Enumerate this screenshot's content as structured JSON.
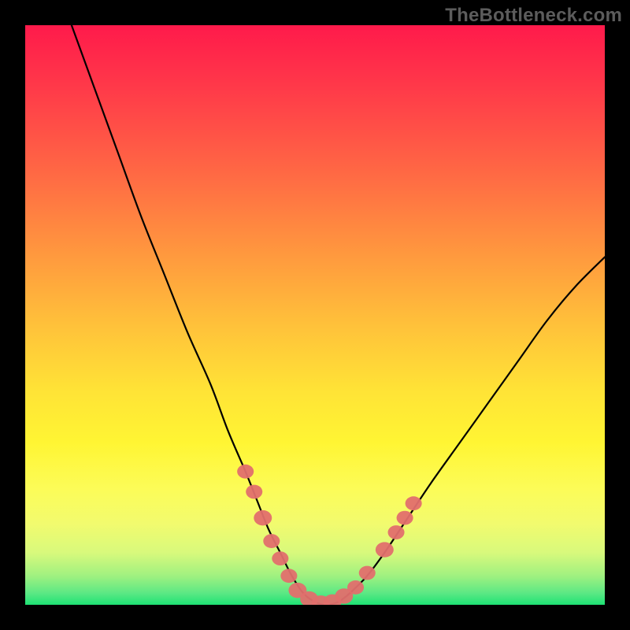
{
  "attribution": "TheBottleneck.com",
  "chart_data": {
    "type": "line",
    "title": "",
    "xlabel": "",
    "ylabel": "",
    "xlim": [
      0,
      100
    ],
    "ylim": [
      0,
      100
    ],
    "series": [
      {
        "name": "bottleneck-curve",
        "x": [
          8,
          12,
          16,
          20,
          24,
          28,
          32,
          35,
          38,
          40,
          42,
          44,
          46,
          48,
          50,
          52,
          54,
          56,
          59,
          62,
          66,
          70,
          75,
          80,
          85,
          90,
          95,
          100
        ],
        "y": [
          100,
          89,
          78,
          67,
          57,
          47,
          38,
          30,
          23,
          18,
          13,
          9,
          5,
          2,
          0.5,
          0,
          0.5,
          2,
          5,
          9,
          15,
          21,
          28,
          35,
          42,
          49,
          55,
          60
        ]
      }
    ],
    "markers": {
      "name": "highlighted-points",
      "points": [
        {
          "x": 38,
          "y": 23,
          "r": 2.2
        },
        {
          "x": 39.5,
          "y": 19.5,
          "r": 2.2
        },
        {
          "x": 41,
          "y": 15,
          "r": 2.4
        },
        {
          "x": 42.5,
          "y": 11,
          "r": 2.2
        },
        {
          "x": 44,
          "y": 8,
          "r": 2.2
        },
        {
          "x": 45.5,
          "y": 5,
          "r": 2.2
        },
        {
          "x": 47,
          "y": 2.5,
          "r": 2.4
        },
        {
          "x": 49,
          "y": 1,
          "r": 2.4
        },
        {
          "x": 51,
          "y": 0.3,
          "r": 2.4
        },
        {
          "x": 53,
          "y": 0.5,
          "r": 2.4
        },
        {
          "x": 55,
          "y": 1.5,
          "r": 2.4
        },
        {
          "x": 57,
          "y": 3,
          "r": 2.2
        },
        {
          "x": 59,
          "y": 5.5,
          "r": 2.2
        },
        {
          "x": 62,
          "y": 9.5,
          "r": 2.4
        },
        {
          "x": 64,
          "y": 12.5,
          "r": 2.2
        },
        {
          "x": 65.5,
          "y": 15,
          "r": 2.2
        },
        {
          "x": 67,
          "y": 17.5,
          "r": 2.2
        }
      ]
    },
    "colors": {
      "curve": "#000000",
      "marker": "#e16f6d"
    }
  }
}
